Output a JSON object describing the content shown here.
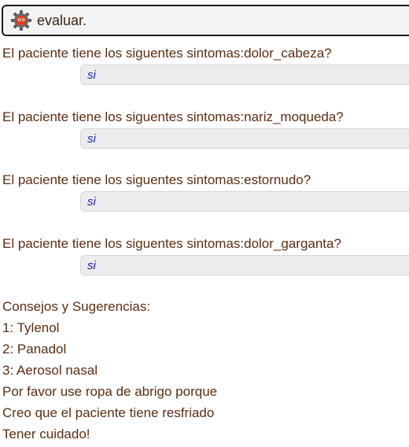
{
  "query": {
    "text": "evaluar."
  },
  "qa": [
    {
      "question": "El paciente tiene los siguentes sintomas:dolor_cabeza?",
      "answer": "si"
    },
    {
      "question": "El paciente tiene los siguentes sintomas:nariz_moqueda?",
      "answer": "si"
    },
    {
      "question": "El paciente tiene los siguentes sintomas:estornudo?",
      "answer": "si"
    },
    {
      "question": "El paciente tiene los siguentes sintomas:dolor_garganta?",
      "answer": "si"
    }
  ],
  "advice": {
    "heading": "Consejos y Sugerencias:",
    "items": [
      "1: Tylenol",
      "2: Panadol",
      "3: Aerosol nasal"
    ],
    "lines": [
      "Por favor use ropa de abrigo porque",
      "Creo que el paciente tiene resfriado",
      "Tener cuidado!"
    ]
  },
  "icons": {
    "query_icon": "gear-icon"
  },
  "colors": {
    "text": "#5a2e12",
    "answer_text": "#2020a8",
    "answer_bg": "#ececec"
  }
}
